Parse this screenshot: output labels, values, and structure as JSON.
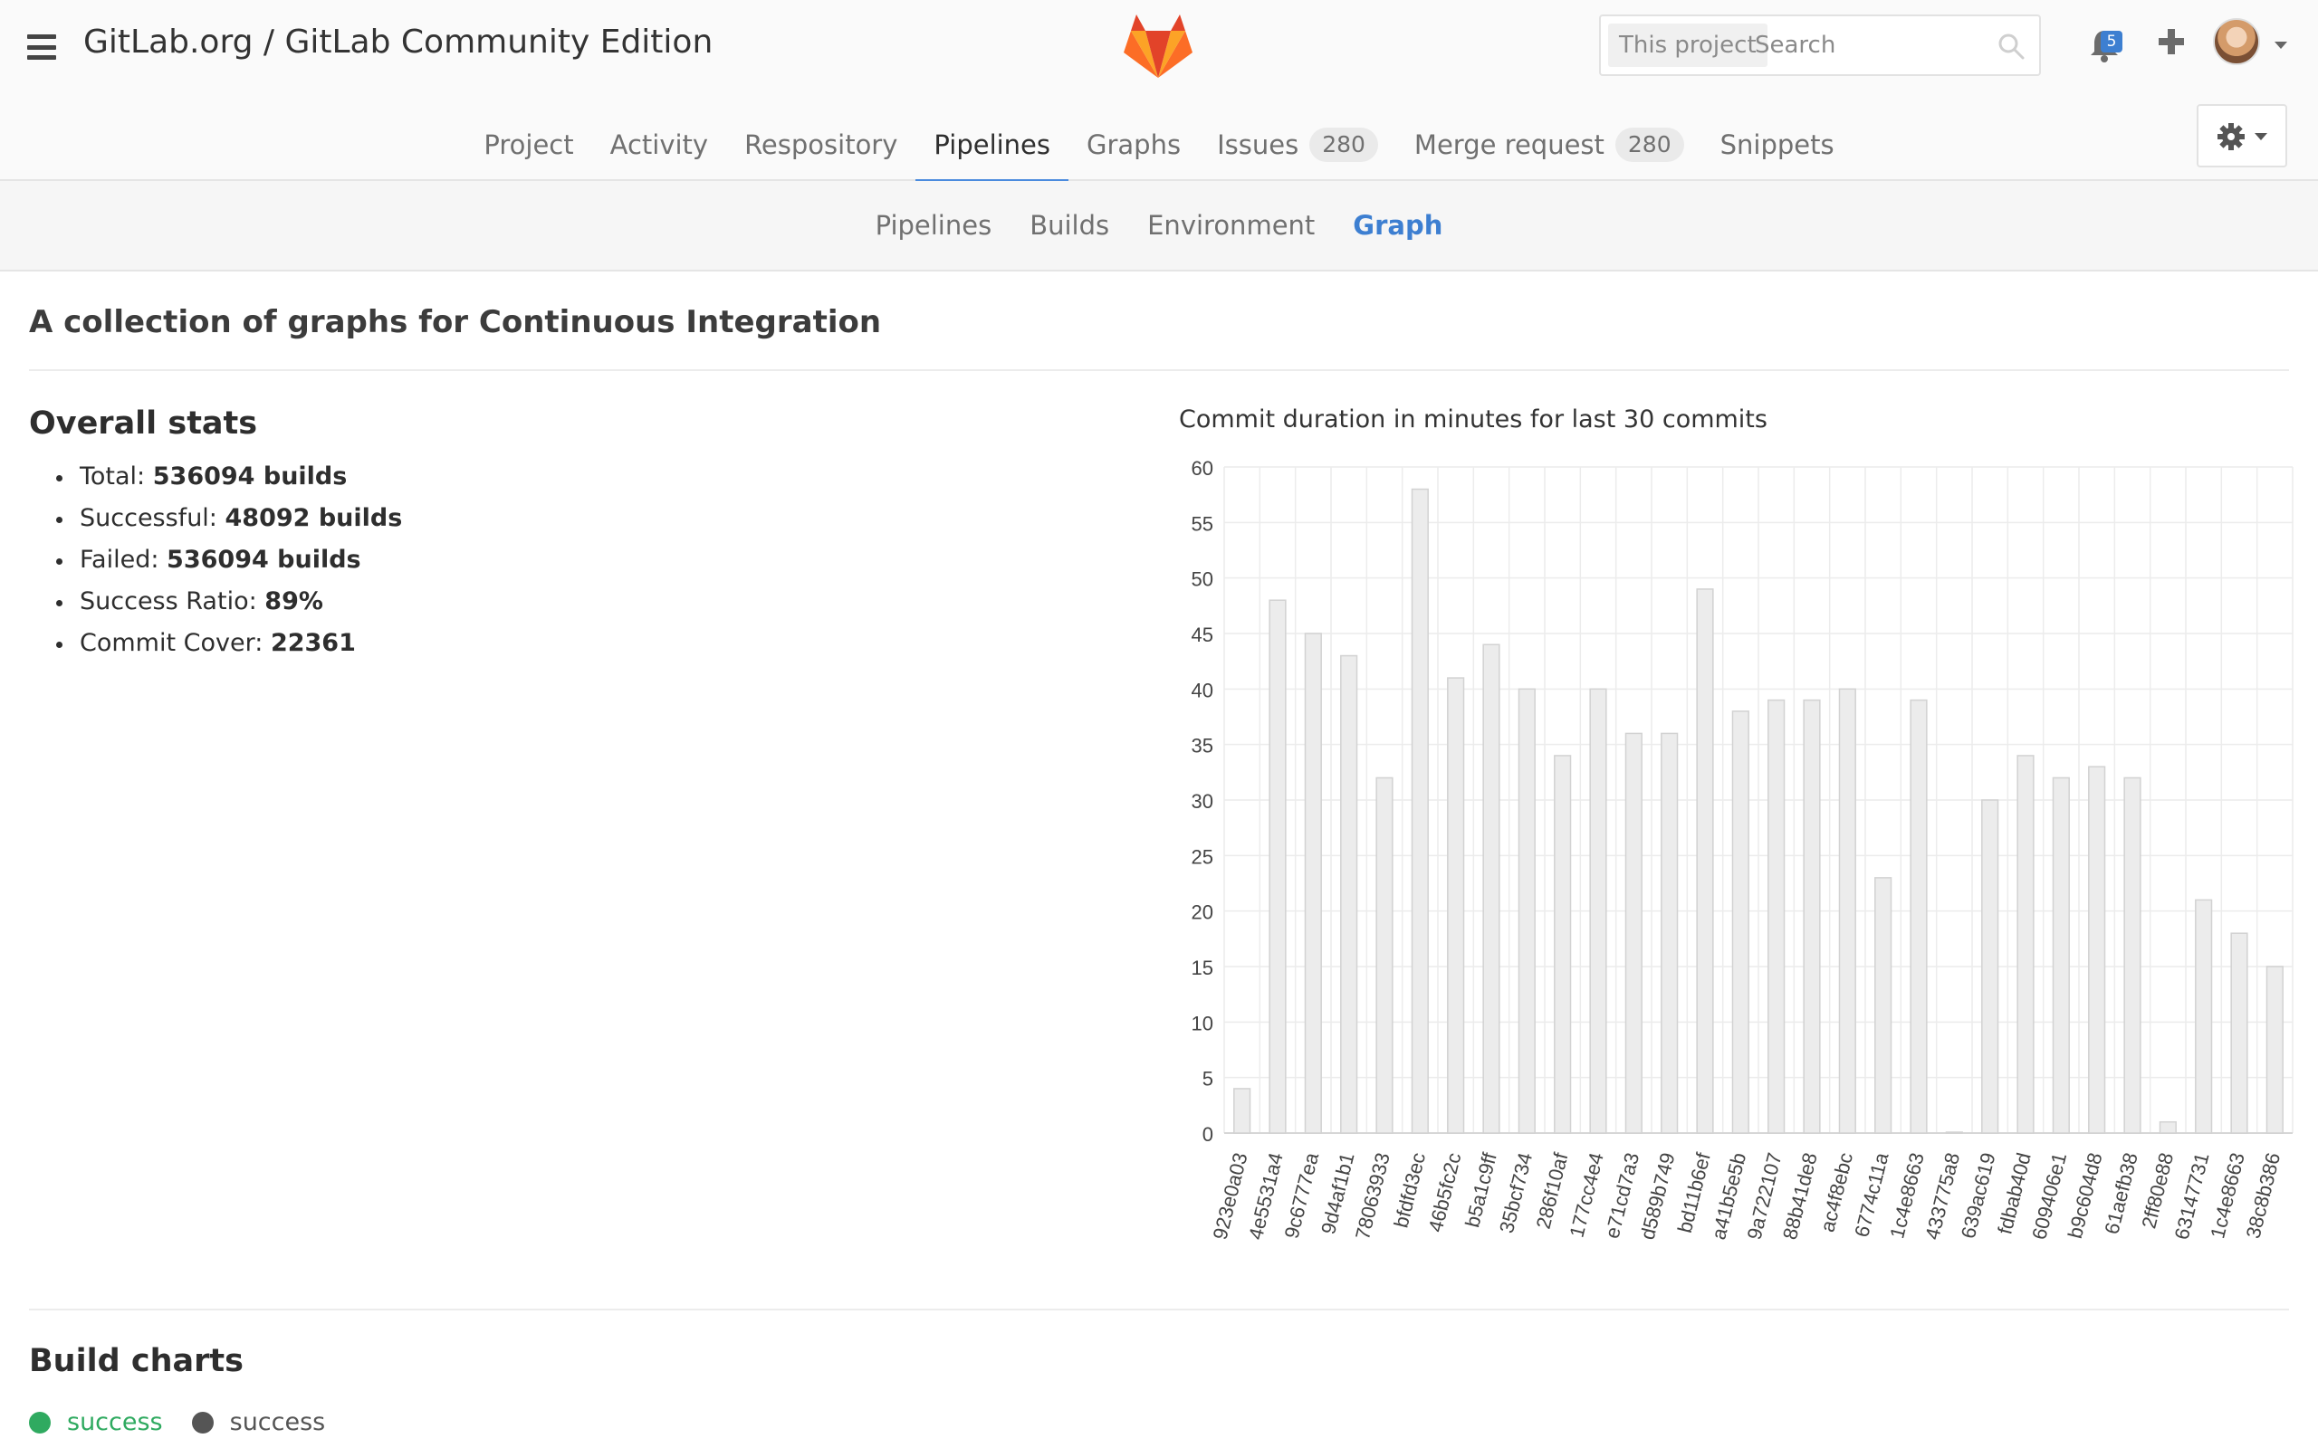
{
  "header": {
    "title": "GitLab.org / GitLab Community Edition",
    "search": {
      "scope": "This project",
      "placeholder": "Search"
    },
    "notifications_count": "5",
    "icons": [
      "hamburger-icon",
      "gitlab-logo",
      "search-icon",
      "bell-icon",
      "plus-icon",
      "avatar",
      "gear-icon"
    ]
  },
  "main_nav": {
    "items": [
      {
        "label": "Project"
      },
      {
        "label": "Activity"
      },
      {
        "label": "Respository"
      },
      {
        "label": "Pipelines",
        "active": true
      },
      {
        "label": "Graphs"
      },
      {
        "label": "Issues",
        "count": "280"
      },
      {
        "label": "Merge request",
        "count": "280"
      },
      {
        "label": "Snippets"
      }
    ]
  },
  "sub_nav": {
    "items": [
      {
        "label": "Pipelines"
      },
      {
        "label": "Builds"
      },
      {
        "label": "Environment"
      },
      {
        "label": "Graph",
        "active": true
      }
    ]
  },
  "page": {
    "heading": "A collection of graphs for Continuous Integration",
    "stats_title": "Overall stats",
    "stats": [
      {
        "label": "Total:",
        "value": "536094 builds"
      },
      {
        "label": "Successful:",
        "value": "48092 builds"
      },
      {
        "label": "Failed:",
        "value": "536094 builds"
      },
      {
        "label": "Success Ratio:",
        "value": "89%"
      },
      {
        "label": "Commit Cover:",
        "value": "22361"
      }
    ],
    "chart_title": "Commit duration in minutes for last 30 commits",
    "build_charts_title": "Build charts",
    "legend": [
      {
        "label": "success",
        "color": "#2faa60"
      },
      {
        "label": "success",
        "color": "#555555"
      }
    ]
  },
  "colors": {
    "accent": "#4a8bde",
    "active_subnav": "#3d7fd1",
    "bar_fill": "#ececec",
    "bar_stroke": "#d2d2d2"
  },
  "chart_data": {
    "type": "bar",
    "title": "Commit duration in minutes for last 30 commits",
    "xlabel": "",
    "ylabel": "",
    "ylim": [
      0,
      60
    ],
    "yticks": [
      "0",
      "5",
      "10",
      "15",
      "20",
      "25",
      "30",
      "35",
      "40",
      "45",
      "50",
      "55",
      "60"
    ],
    "grid": true,
    "categories": [
      "923e0a03",
      "4e5531a4",
      "9c6777ea",
      "9d4af1b1",
      "78063933",
      "bfdfd3ec",
      "46b5fc2c",
      "b5a1c9ff",
      "35bcf734",
      "286f10af",
      "177cc4e4",
      "e71cd7a3",
      "d589b749",
      "bd11b6ef",
      "a41b5e5b",
      "9a722107",
      "88b41de8",
      "ac4f8ebc",
      "6774c11a",
      "1c4e8663",
      "433775a8",
      "639ac619",
      "fdbab40d",
      "609406e1",
      "b9c604d8",
      "61aefb38",
      "2ff80e88",
      "63147731",
      "1c4e8663",
      "38c8b386"
    ],
    "values": [
      4,
      48,
      45,
      43,
      32,
      58,
      41,
      44,
      40,
      34,
      40,
      36,
      36,
      49,
      38,
      39,
      39,
      40,
      23,
      39,
      0,
      30,
      34,
      32,
      33,
      32,
      1,
      21,
      18,
      15
    ]
  }
}
